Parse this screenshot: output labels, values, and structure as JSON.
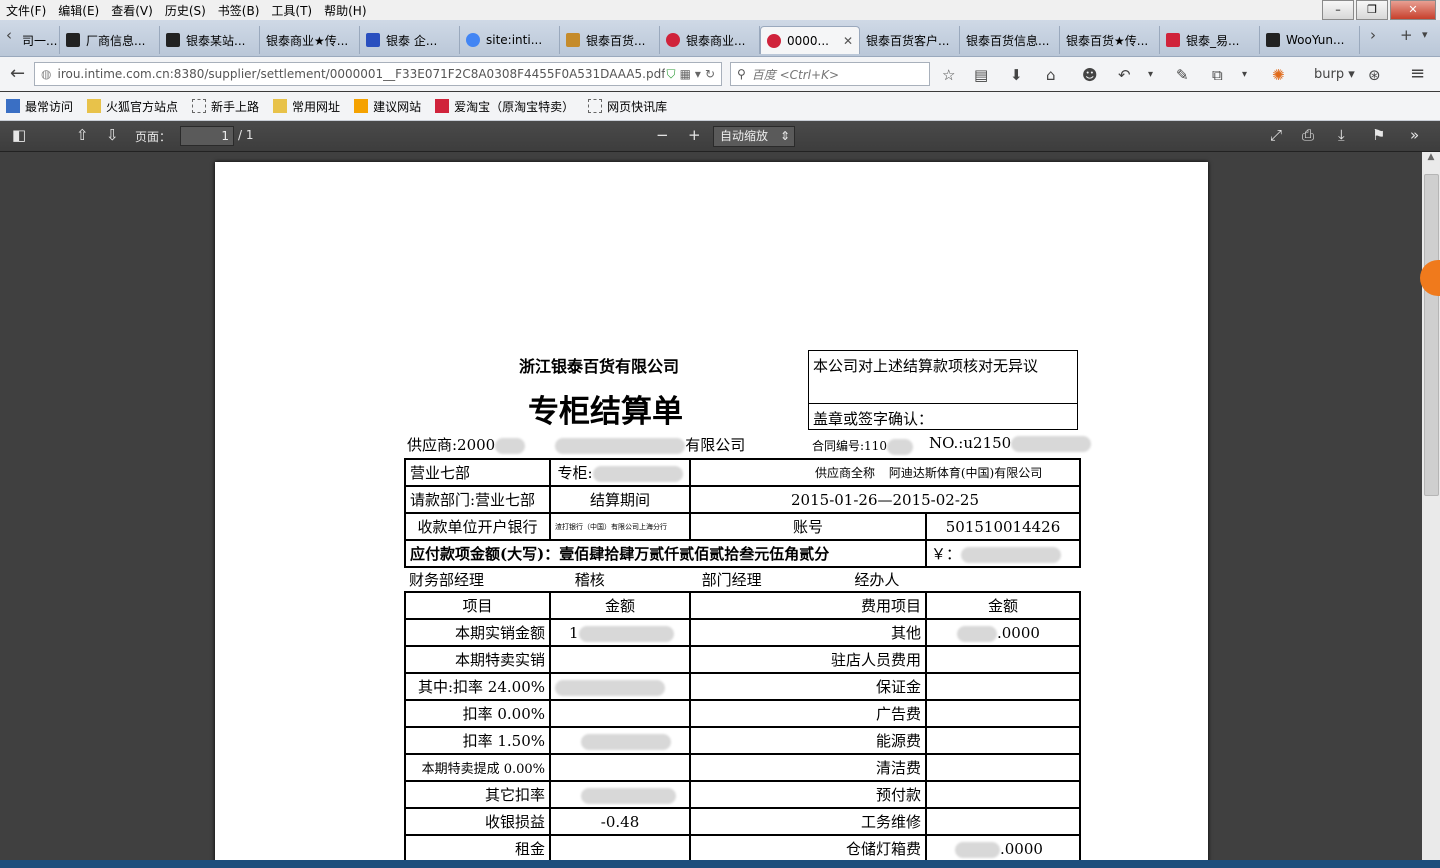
{
  "menu": [
    "文件(F)",
    "编辑(E)",
    "查看(V)",
    "历史(S)",
    "书签(B)",
    "工具(T)",
    "帮助(H)"
  ],
  "tabs": [
    {
      "label": "司一...",
      "color": "#fff"
    },
    {
      "label": "厂商信息...",
      "color": "#222"
    },
    {
      "label": "银泰某站...",
      "color": "#222"
    },
    {
      "label": "银泰商业★传...",
      "color": "#fff"
    },
    {
      "label": "银泰 企...",
      "color": "#2a4fbf"
    },
    {
      "label": "site:inti...",
      "color": "#4285f4"
    },
    {
      "label": "银泰百货...",
      "color": "#c58b2b"
    },
    {
      "label": "银泰商业...",
      "color": "#d0233b"
    },
    {
      "label": "0000...",
      "color": "#d0233b"
    },
    {
      "label": "银泰百货客户...",
      "color": "#fff"
    },
    {
      "label": "银泰百货信息...",
      "color": "#fff"
    },
    {
      "label": "银泰百货★传...",
      "color": "#fff"
    },
    {
      "label": "银泰_易...",
      "color": "#d0233b"
    },
    {
      "label": "WooYun...",
      "color": "#222"
    }
  ],
  "url": "irou.intime.com.cn:8380/supplier/settlement/0000001__F33E071F2C8A0308F4455F0A531DAAA5.pdf",
  "search_placeholder": "百度 <Ctrl+K>",
  "burp_label": "burp",
  "bookmarks": [
    "最常访问",
    "火狐官方站点",
    "新手上路",
    "常用网址",
    "建议网站",
    "爱淘宝（原淘宝特卖）",
    "网页快讯库"
  ],
  "pdf": {
    "page_label": "页面：",
    "page_value": "1",
    "page_total": "/ 1",
    "zoom": "自动缩放"
  },
  "doc": {
    "company": "浙江银泰百货有限公司",
    "title": "专柜结算单",
    "confirm_text": "本公司对上述结算款项核对无异议",
    "stamp_text": "盖章或签字确认：",
    "supplier": "供应商:2000",
    "supplier_tail": "有限公司",
    "contract": "合同编号:110",
    "no": "NO.:u2150",
    "dept": "营业七部",
    "counter": "专柜:",
    "supplier_fullname_label": "供应商全称",
    "supplier_fullname": "阿迪达斯体育(中国)有限公司",
    "request_dept": "请款部门:营业七部",
    "period_label": "结算期间",
    "period": "2015-01-26—2015-02-25",
    "bank_label": "收款单位开户银行",
    "bank": "渣打银行（中国）有限公司上海分行",
    "account_label": "账号",
    "account": "501510014426",
    "amount_label": "应付款项金额(大写)：壹佰肆拾肆万贰仟贰佰贰拾叁元伍角贰分",
    "amount_sym": "￥：",
    "sign_row": [
      "财务部经理",
      "稽核",
      "部门经理",
      "经办人"
    ],
    "headers": [
      "项目",
      "金额",
      "费用项目",
      "金额"
    ],
    "rows": [
      {
        "item": "本期实销金额",
        "amount": "1",
        "fee": "其他",
        "fee_amount": ".0000"
      },
      {
        "item": "本期特卖实销",
        "amount": "",
        "fee": "驻店人员费用",
        "fee_amount": ""
      },
      {
        "item": "其中:扣率 24.00%",
        "amount": "",
        "fee": "保证金",
        "fee_amount": ""
      },
      {
        "item": "扣率 0.00%",
        "amount": "",
        "fee": "广告费",
        "fee_amount": ""
      },
      {
        "item": "扣率 1.50%",
        "amount": "",
        "fee": "能源费",
        "fee_amount": ""
      },
      {
        "item": "本期特卖提成 0.00%",
        "amount": "",
        "fee": "清洁费",
        "fee_amount": ""
      },
      {
        "item": "其它扣率",
        "amount": "",
        "fee": "预付款",
        "fee_amount": ""
      },
      {
        "item": "收银损益",
        "amount": "-0.48",
        "fee": "工务维修",
        "fee_amount": ""
      },
      {
        "item": "租金",
        "amount": "",
        "fee": "仓储灯箱费",
        "fee_amount": ".0000"
      }
    ]
  }
}
